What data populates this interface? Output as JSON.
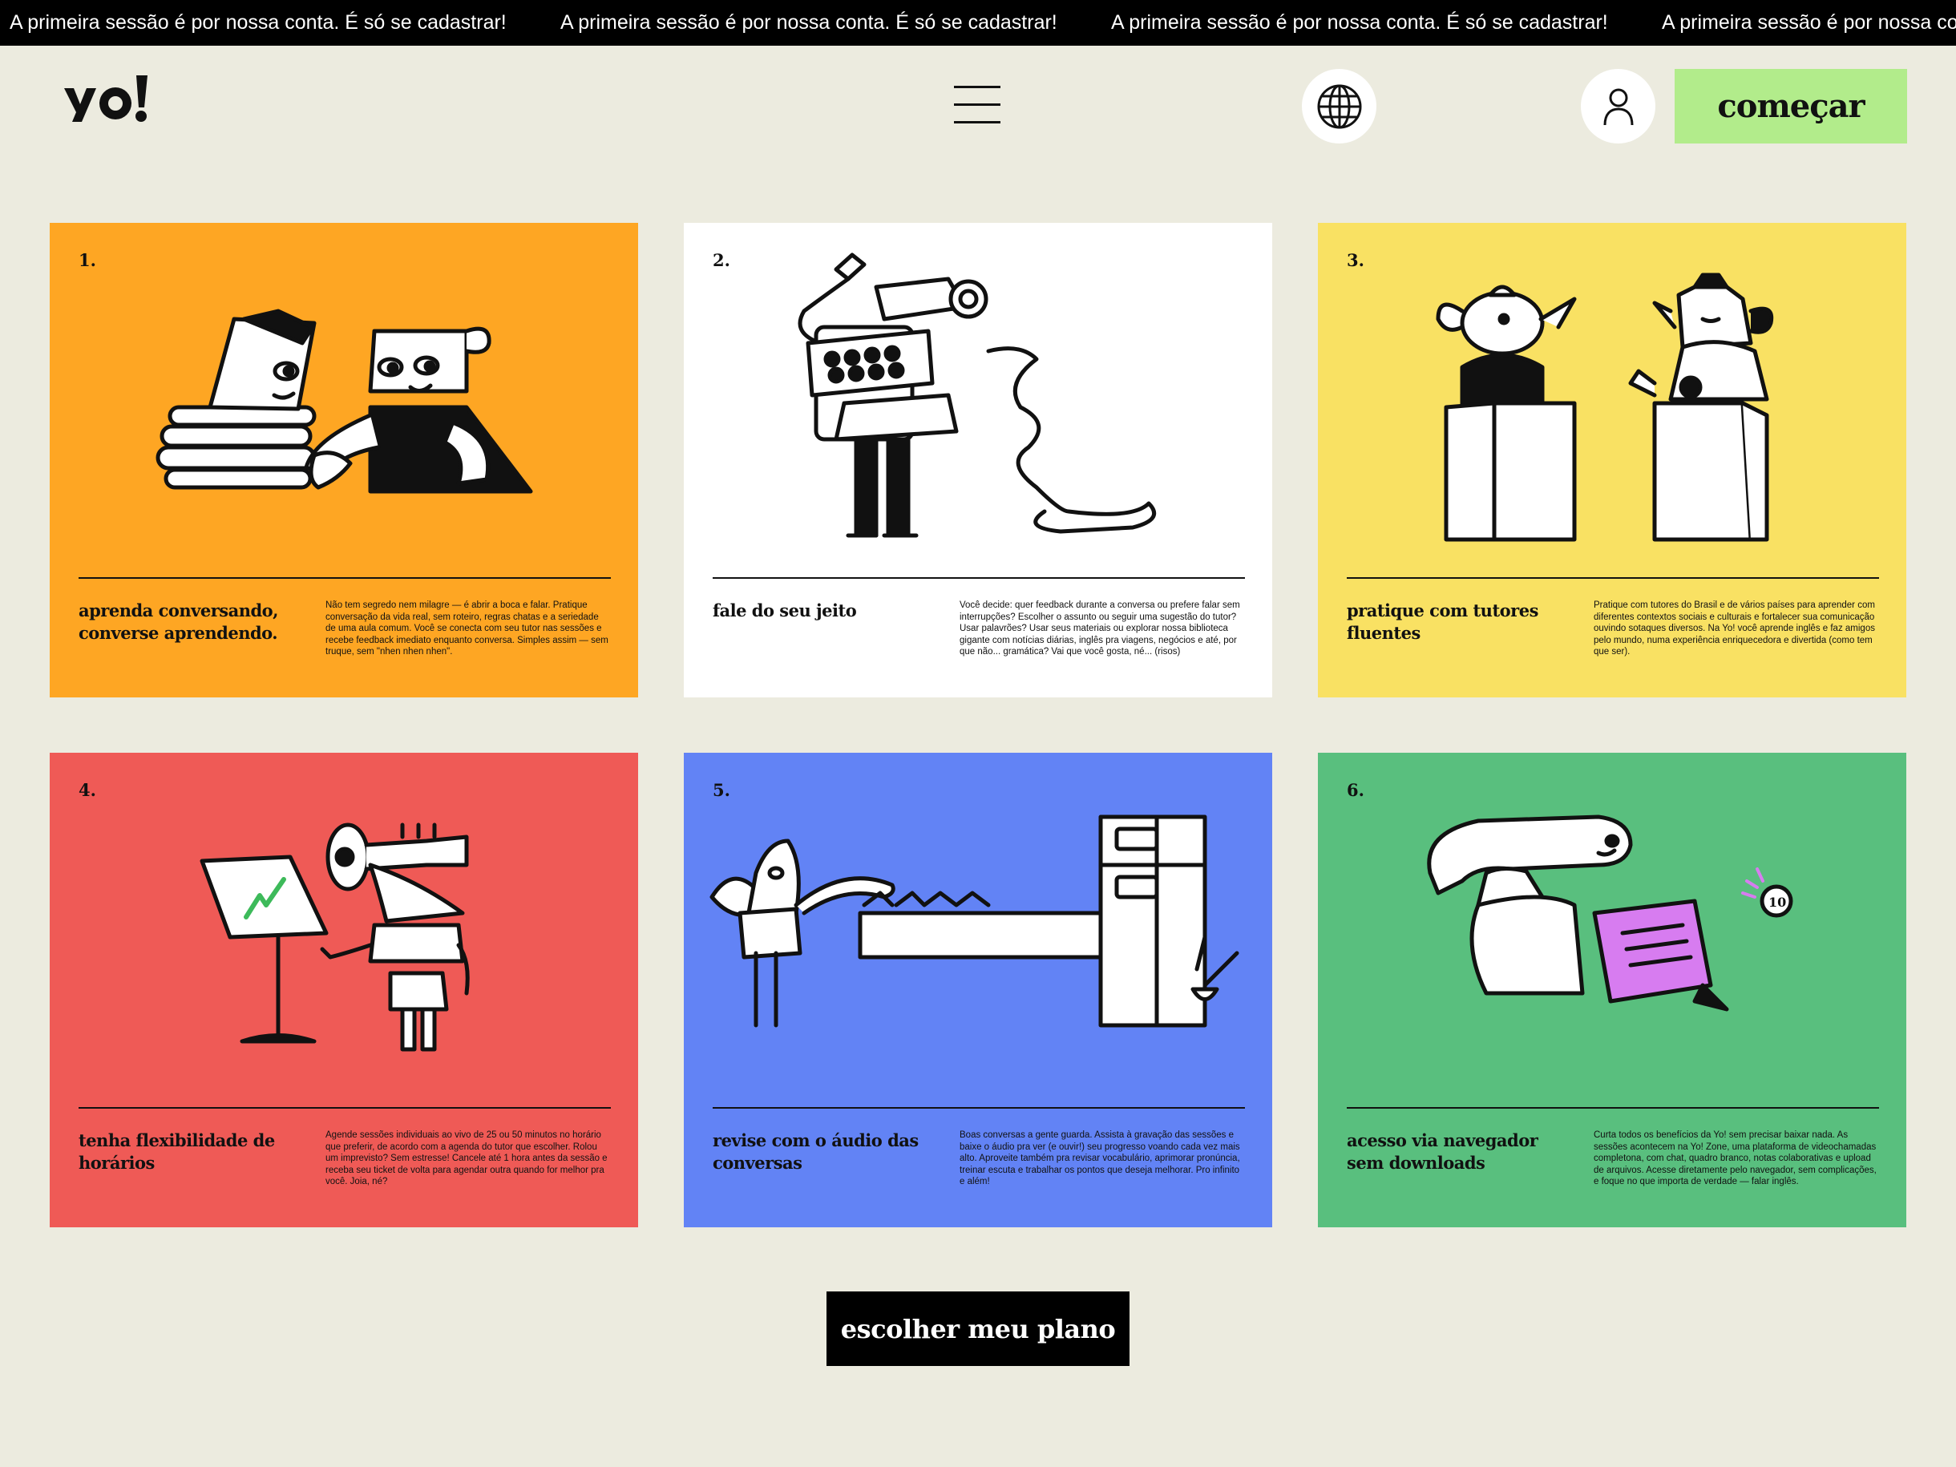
{
  "announcement": {
    "text": "A primeira sessão é por nossa conta. É só se cadastrar!"
  },
  "header": {
    "logo_text": "yo!",
    "start_label": "começar"
  },
  "cards": [
    {
      "number": "1.",
      "title": "aprenda conversando, converse aprendendo.",
      "description": "Não tem segredo nem milagre — é abrir a boca e falar. Pratique conversação da vida real, sem roteiro, regras chatas e a seriedade de uma aula comum. Você se conecta com seu tutor nas sessões e recebe feedback imediato enquanto conversa. Simples assim — sem truque, sem \"nhen nhen nhen\".",
      "color": "#fea623"
    },
    {
      "number": "2.",
      "title": "fale do seu jeito",
      "description": "Você decide: quer feedback durante a conversa ou prefere falar sem interrupções? Escolher o assunto ou seguir uma sugestão do tutor? Usar palavrões? Usar seus materiais ou explorar nossa biblioteca gigante com notícias diárias, inglês pra viagens, negócios e até, por que não... gramática? Vai que você gosta, né... (risos)",
      "color": "#ffffff"
    },
    {
      "number": "3.",
      "title": "pratique com tutores fluentes",
      "description": "Pratique com tutores do Brasil e de vários países para aprender com diferentes contextos sociais e culturais e fortalecer sua comunicação ouvindo sotaques diversos. Na Yo! você aprende inglês e faz amigos pelo mundo, numa experiência enriquecedora e divertida (como tem que ser).",
      "color": "#f9e163"
    },
    {
      "number": "4.",
      "title": "tenha flexibilidade de horários",
      "description": "Agende sessões individuais ao vivo de 25 ou 50 minutos no horário que preferir, de acordo com a agenda do tutor que escolher. Rolou um imprevisto? Sem estresse! Cancele até 1 hora antes da sessão e receba seu ticket de volta para agendar outra quando for melhor pra você. Joia, né?",
      "color": "#ef5a56"
    },
    {
      "number": "5.",
      "title": "revise com o áudio das conversas",
      "description": "Boas conversas a gente guarda. Assista à gravação das sessões e baixe o áudio pra ver (e ouvir!) seu progresso voando cada vez mais alto. Aproveite também pra revisar vocabulário, aprimorar pronúncia, treinar escuta e trabalhar os pontos que deseja melhorar. Pro infinito e além!",
      "color": "#6283f5"
    },
    {
      "number": "6.",
      "title": "acesso via navegador sem downloads",
      "description": "Curta todos os benefícios da Yo! sem precisar baixar nada. As sessões acontecem na Yo! Zone, uma plataforma de videochamadas completona, com chat, quadro branco, notas colaborativas e upload de arquivos. Acesse diretamente pelo navegador, sem complicações, e foque no que importa de verdade — falar inglês.",
      "color": "#59bf7e"
    }
  ],
  "badge_value": "10",
  "cta_label": "escolher meu plano",
  "icons": [
    "globe-icon",
    "user-icon",
    "hamburger-menu-icon"
  ]
}
